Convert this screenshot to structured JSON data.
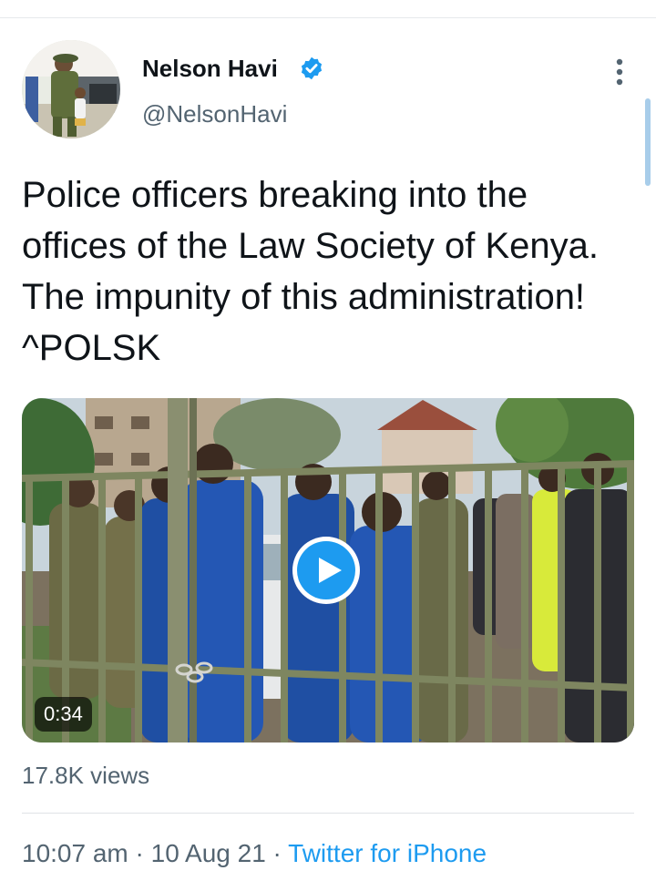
{
  "author": {
    "display_name": "Nelson Havi",
    "handle": "@NelsonHavi",
    "verified": true,
    "avatar_icon": "profile-photo"
  },
  "tweet": {
    "text": "Police officers breaking into the offices of the Law Society of Kenya. The impunity of this administration! ^POLSK"
  },
  "media": {
    "type": "video",
    "duration": "0:34",
    "play_icon": "play-icon"
  },
  "stats": {
    "views": "17.8K views"
  },
  "meta": {
    "time": "10:07 am",
    "separator": "·",
    "date": "10 Aug 21",
    "source": "Twitter for iPhone"
  },
  "colors": {
    "accent": "#1d9bf0",
    "text_primary": "#0f1419",
    "text_secondary": "#536471",
    "divider": "#dfe3e6"
  }
}
